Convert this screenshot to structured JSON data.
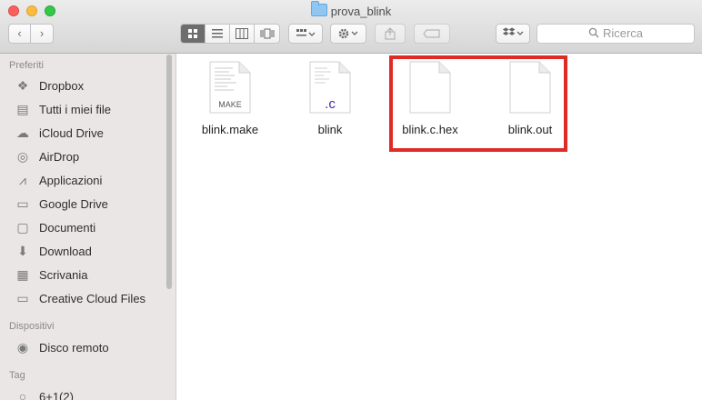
{
  "window": {
    "title": "prova_blink"
  },
  "toolbar": {
    "search_placeholder": "Ricerca"
  },
  "sidebar": {
    "sections": [
      {
        "heading": "Preferiti"
      },
      {
        "heading": "Dispositivi"
      },
      {
        "heading": "Tag"
      }
    ],
    "favorites": [
      {
        "label": "Dropbox",
        "icon": "dropbox-icon"
      },
      {
        "label": "Tutti i miei file",
        "icon": "all-files-icon"
      },
      {
        "label": "iCloud Drive",
        "icon": "cloud-icon"
      },
      {
        "label": "AirDrop",
        "icon": "airdrop-icon"
      },
      {
        "label": "Applicazioni",
        "icon": "applications-icon"
      },
      {
        "label": "Google Drive",
        "icon": "folder-icon"
      },
      {
        "label": "Documenti",
        "icon": "document-icon"
      },
      {
        "label": "Download",
        "icon": "download-icon"
      },
      {
        "label": "Scrivania",
        "icon": "desktop-icon"
      },
      {
        "label": "Creative Cloud Files",
        "icon": "folder-icon"
      }
    ],
    "devices": [
      {
        "label": "Disco remoto",
        "icon": "disc-icon"
      }
    ],
    "tags": [
      {
        "label": "6+1(2)",
        "icon": "tag-icon"
      }
    ]
  },
  "files": [
    {
      "name": "blink.make",
      "badge": "MAKE",
      "badge_color": "#555555"
    },
    {
      "name": "blink",
      "badge": ".c",
      "badge_color": "#4b2a9a"
    },
    {
      "name": "blink.c.hex",
      "badge": ""
    },
    {
      "name": "blink.out",
      "badge": ""
    }
  ],
  "colors": {
    "highlight": "#e02a26"
  }
}
